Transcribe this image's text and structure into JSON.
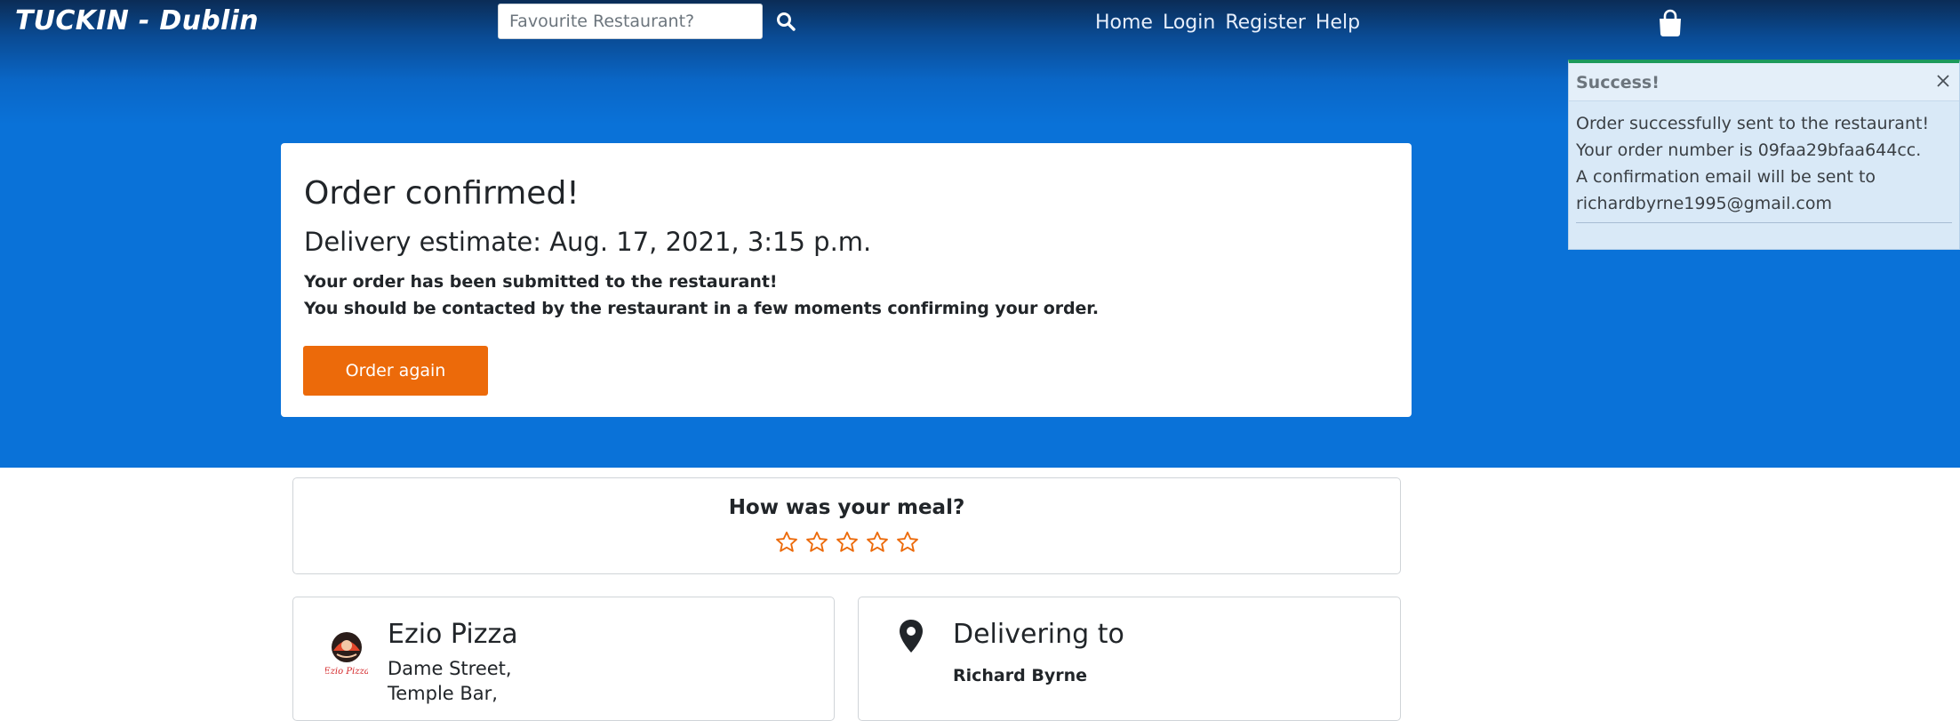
{
  "header": {
    "brand": "TUCKIN - Dublin",
    "search": {
      "placeholder": "Favourite Restaurant?",
      "value": ""
    },
    "nav": [
      "Home",
      "Login",
      "Register",
      "Help"
    ]
  },
  "confirmation": {
    "title": "Order confirmed!",
    "delivery_estimate": "Delivery estimate: Aug. 17, 2021, 3:15 p.m.",
    "line1": "Your order has been submitted to the restaurant!",
    "line2_prefix": "You should be ",
    "line2_bold": "contacted by the restaurant",
    "line2_suffix": " in a few moments confirming your order.",
    "order_again_label": "Order again"
  },
  "toast": {
    "title": "Success!",
    "lines": [
      "Order successfully sent to the restaurant!",
      "Your order number is 09faa29bfaa644cc.",
      "A confirmation email will be sent to",
      "richardbyrne1995@gmail.com"
    ]
  },
  "rating": {
    "title": "How was your meal?",
    "stars": 5,
    "selected": 0
  },
  "restaurant": {
    "name": "Ezio Pizza",
    "address_lines": [
      "Dame Street,",
      "Temple Bar,"
    ],
    "logo_text": "Ezio Pizza"
  },
  "delivery": {
    "title": "Delivering to",
    "name": "Richard Byrne"
  },
  "colors": {
    "accent": "#ec6a0a",
    "hero_blue": "#0a72d8",
    "toast_border": "#1d9a5b"
  }
}
